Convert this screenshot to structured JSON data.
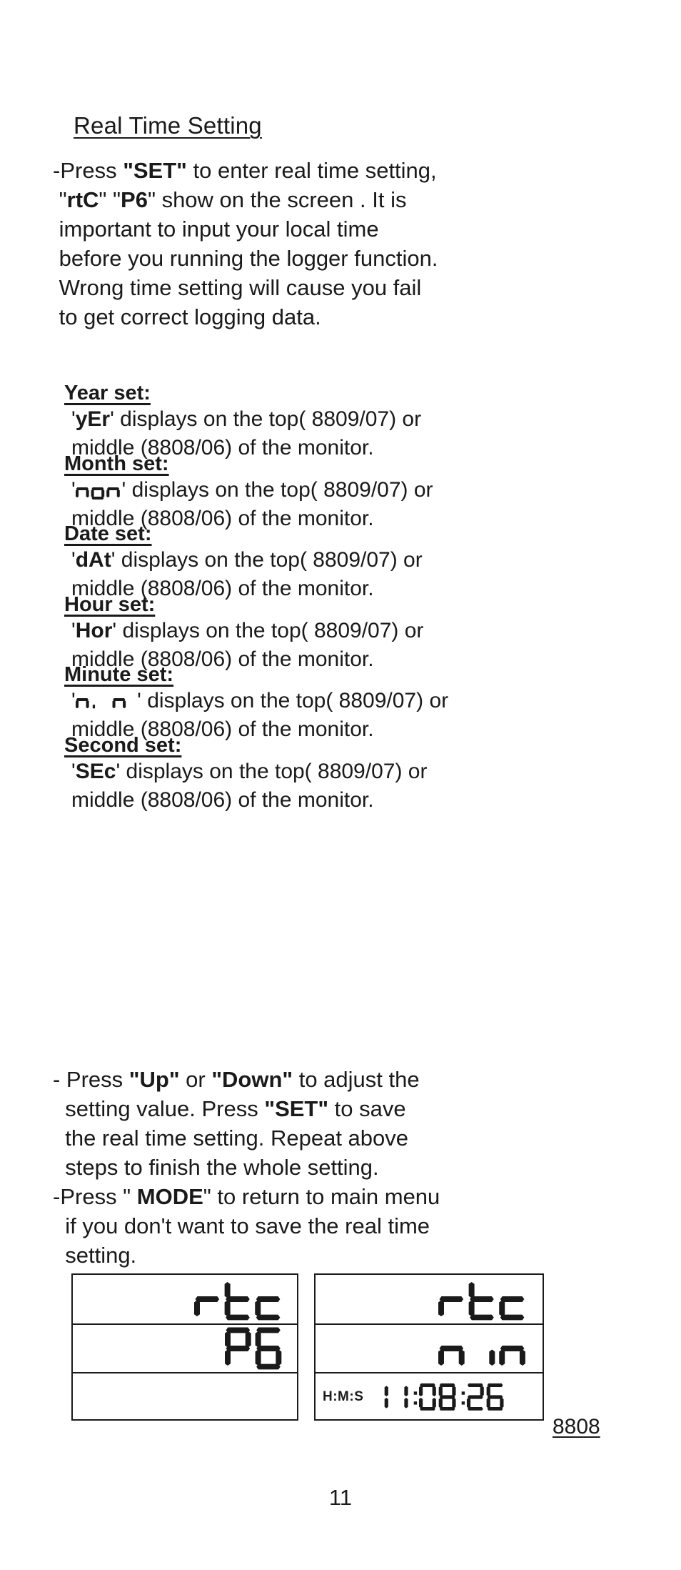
{
  "heading": "Real Time Setting",
  "intro": {
    "lines": [
      {
        "segments": [
          {
            "t": "-Press ",
            "b": false
          },
          {
            "t": "\"SET\"",
            "b": true
          },
          {
            "t": " to enter real time setting,",
            "b": false
          }
        ]
      },
      {
        "segments": [
          {
            "t": " \"",
            "b": false
          },
          {
            "t": "rtC",
            "b": true
          },
          {
            "t": "\" \"",
            "b": false
          },
          {
            "t": "P6",
            "b": true
          },
          {
            "t": "\" show on the screen . It is",
            "b": false
          }
        ]
      },
      {
        "segments": [
          {
            "t": " important to input your local time",
            "b": false
          }
        ]
      },
      {
        "segments": [
          {
            "t": " before you running the logger function.",
            "b": false
          }
        ]
      },
      {
        "segments": [
          {
            "t": " Wrong time setting will cause you fail",
            "b": false
          }
        ]
      },
      {
        "segments": [
          {
            "t": " to get correct logging data.",
            "b": false
          }
        ]
      }
    ]
  },
  "sections": [
    {
      "title": "Year set:",
      "code": "yEr",
      "code_type": "text",
      "line1_before": "'",
      "line1_after": "' displays on the top( 8809/07) or",
      "line2": "middle (8808/06) of the monitor."
    },
    {
      "title": "Month set:",
      "code": "non",
      "code_type": "lcd",
      "line1_before": "'",
      "line1_after": "' displays on the top( 8809/07) or",
      "line2": "middle (8808/06) of the monitor."
    },
    {
      "title": "Date set:",
      "code": "dAt",
      "code_type": "text",
      "line1_before": "'",
      "line1_after": "' displays on the top( 8809/07) or",
      "line2": "middle (8808/06) of the monitor."
    },
    {
      "title": "Hour set:",
      "code": "Hor",
      "code_type": "text",
      "line1_before": "'",
      "line1_after": "' displays on the top( 8809/07) or",
      "line2": "middle (8808/06) of the monitor."
    },
    {
      "title": "Minute set:",
      "code": "n, n",
      "code_type": "lcd",
      "line1_before": "'",
      "line1_after": "' displays on the top( 8809/07) or",
      "line2": "middle (8808/06) of the monitor."
    },
    {
      "title": "Second set:",
      "code": "SEc",
      "code_type": "text",
      "line1_before": "'",
      "line1_after": "' displays on the top( 8809/07) or",
      "line2": "middle (8808/06) of the monitor."
    }
  ],
  "outro": {
    "lines": [
      {
        "segments": [
          {
            "t": "- Press ",
            "b": false
          },
          {
            "t": "\"Up\"",
            "b": true
          },
          {
            "t": " or ",
            "b": false
          },
          {
            "t": "\"Down\"",
            "b": true
          },
          {
            "t": " to adjust the",
            "b": false
          }
        ]
      },
      {
        "segments": [
          {
            "t": "  setting value. Press ",
            "b": false
          },
          {
            "t": "\"SET\"",
            "b": true
          },
          {
            "t": " to save",
            "b": false
          }
        ]
      },
      {
        "segments": [
          {
            "t": "  the real time setting. Repeat above",
            "b": false
          }
        ]
      },
      {
        "segments": [
          {
            "t": "  steps to finish the whole setting.",
            "b": false
          }
        ]
      },
      {
        "segments": [
          {
            "t": "-Press \" ",
            "b": false
          },
          {
            "t": "MODE",
            "b": true
          },
          {
            "t": "\" to return to main menu",
            "b": false
          }
        ]
      },
      {
        "segments": [
          {
            "t": "  if you don't want to save the real time",
            "b": false
          }
        ]
      },
      {
        "segments": [
          {
            "t": "  setting.",
            "b": false
          }
        ]
      }
    ]
  },
  "lcd_panels": [
    {
      "name": "left-panel",
      "rows": [
        {
          "label": "",
          "display": "rtC",
          "display_raw": "rtc"
        },
        {
          "label": "",
          "display": "P6",
          "display_raw": "P6"
        },
        {
          "label": "",
          "display": "",
          "display_raw": ""
        }
      ]
    },
    {
      "name": "right-panel",
      "rows": [
        {
          "label": "",
          "display": "rtC",
          "display_raw": "rtc"
        },
        {
          "label": "",
          "display": "nin",
          "display_raw": "nin"
        },
        {
          "label": "H:M:S",
          "display": "11:08:26",
          "display_raw": "11:08:26"
        }
      ]
    }
  ],
  "model_label": "8808",
  "page_number": "11"
}
